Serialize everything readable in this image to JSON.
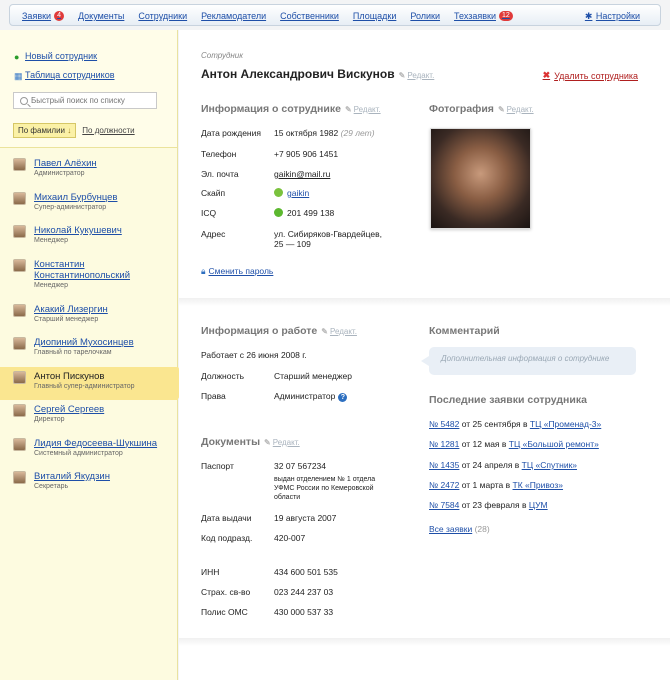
{
  "nav": {
    "items": [
      {
        "label": "Заявки",
        "badge": "4"
      },
      {
        "label": "Документы"
      },
      {
        "label": "Сотрудники"
      },
      {
        "label": "Рекламодатели"
      },
      {
        "label": "Собственники"
      },
      {
        "label": "Площадки"
      },
      {
        "label": "Ролики"
      },
      {
        "label": "Техзаявки",
        "badge": "12"
      }
    ],
    "settings": "Настройки"
  },
  "sidebar": {
    "new_employee": "Новый сотрудник",
    "employee_table": "Таблица сотрудников",
    "search_placeholder": "Быстрый поиск по списку",
    "sort_by_name": "По фамилии",
    "sort_by_position": "По должности",
    "employees": [
      {
        "name": "Павел Алёхин",
        "role": "Администратор"
      },
      {
        "name": "Михаил Бурбунцев",
        "role": "Супер-администратор"
      },
      {
        "name": "Николай Кукушевич",
        "role": "Менеджер"
      },
      {
        "name": "Константин Константинопольский",
        "role": "Менеджер"
      },
      {
        "name": "Акакий Лизергин",
        "role": "Старший менеджер"
      },
      {
        "name": "Диопиний Мухосинцев",
        "role": "Главный по тарелочкам"
      },
      {
        "name": "Антон Пискунов",
        "role": "Главный супер-администратор",
        "active": true
      },
      {
        "name": "Сергей Сергеев",
        "role": "Директор"
      },
      {
        "name": "Лидия Федосеева-Шукшина",
        "role": "Системный администратор"
      },
      {
        "name": "Виталий Якудзин",
        "role": "Секретарь"
      }
    ]
  },
  "employee": {
    "label": "Сотрудник",
    "name": "Антон Александрович Вискунов",
    "edit": "Редакт.",
    "delete": "Удалить сотрудника"
  },
  "info": {
    "title": "Информация о сотруднике",
    "edit": "Редакт.",
    "birth_label": "Дата рождения",
    "birth_value": "15 октября 1982",
    "birth_age": "(29 лет)",
    "phone_label": "Телефон",
    "phone_value": "+7 905 906 1451",
    "email_label": "Эл. почта",
    "email_value": "gaikin@mail.ru",
    "skype_label": "Скайп",
    "skype_value": "gaikin",
    "icq_label": "ICQ",
    "icq_value": "201 499 138",
    "address_label": "Адрес",
    "address_line1": "ул. Сибиряков-Гвардейцев,",
    "address_line2": "25 — 109",
    "change_password": "Сменить пароль"
  },
  "photo": {
    "title": "Фотография",
    "edit": "Редакт."
  },
  "work": {
    "title": "Информация о работе",
    "edit": "Редакт.",
    "since": "Работает с 26 июня 2008 г.",
    "position_label": "Должность",
    "position_value": "Старший менеджер",
    "rights_label": "Права",
    "rights_value": "Администратор",
    "help": "?"
  },
  "comment": {
    "title": "Комментарий",
    "placeholder": "Дополнительная информация о сотруднике"
  },
  "requests": {
    "title": "Последние заявки сотрудника",
    "items": [
      {
        "num": "№ 5482",
        "text": " от 25 сентября в ",
        "place": "ТЦ «Променад-3»"
      },
      {
        "num": "№ 1281",
        "text": " от 12 мая в ",
        "place": "ТЦ «Большой ремонт»"
      },
      {
        "num": "№ 1435",
        "text": " от 24 апреля в ",
        "place": "ТЦ «Спутник»"
      },
      {
        "num": "№ 2472",
        "text": " от 1 марта в ",
        "place": "ТК «Привоз»"
      },
      {
        "num": "№ 7584",
        "text": " от 23 февраля в ",
        "place": "ЦУМ"
      }
    ],
    "all": "Все заявки",
    "all_count": "(28)"
  },
  "documents": {
    "title": "Документы",
    "edit": "Редакт.",
    "passport_label": "Паспорт",
    "passport_value": "32 07 567234",
    "issued_by_1": "выдан отделением № 1 отдела",
    "issued_by_2": "УФМС России по Кемеровской",
    "issued_by_3": "области",
    "issue_date_label": "Дата выдачи",
    "issue_date_value": "19 августа 2007",
    "code_label": "Код подразд.",
    "code_value": "420-007",
    "inn_label": "ИНН",
    "inn_value": "434 600 501 535",
    "snils_label": "Страх. св-во",
    "snils_value": "023 244 237 03",
    "oms_label": "Полис ОМС",
    "oms_value": "430 000 537 33"
  }
}
